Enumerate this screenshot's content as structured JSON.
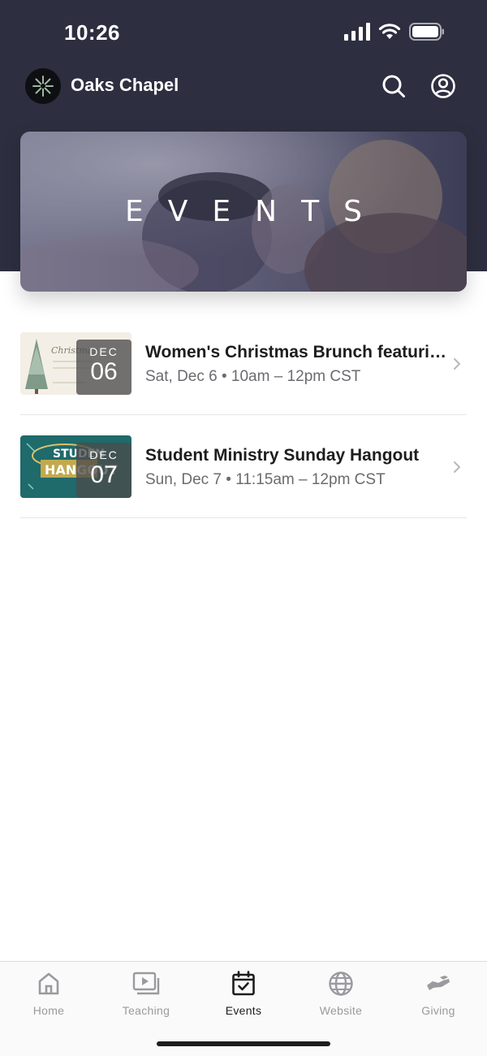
{
  "status_bar": {
    "time": "10:26",
    "icons": [
      "signal-icon",
      "wifi-icon",
      "battery-icon"
    ]
  },
  "header": {
    "app_name": "Oaks Chapel",
    "icons": [
      "search-icon",
      "profile-icon"
    ]
  },
  "hero": {
    "title": "EVENTS"
  },
  "events": [
    {
      "month": "DEC",
      "day": "06",
      "title": "Women's Christmas Brunch featuring...",
      "meta": "Sat, Dec 6 • 10am – 12pm CST"
    },
    {
      "month": "DEC",
      "day": "07",
      "title": "Student Ministry Sunday Hangout",
      "meta": "Sun, Dec 7 • 11:15am – 12pm CST"
    }
  ],
  "tabs": [
    {
      "label": "Home",
      "icon": "home-icon"
    },
    {
      "label": "Teaching",
      "icon": "video-icon"
    },
    {
      "label": "Events",
      "icon": "calendar-icon",
      "active": true
    },
    {
      "label": "Website",
      "icon": "globe-icon"
    },
    {
      "label": "Giving",
      "icon": "giving-hand-icon"
    }
  ],
  "colors": {
    "header_bg": "#2d2f40",
    "active_tab": "#1d1d1f",
    "inactive_tab": "#9a9a9f"
  }
}
